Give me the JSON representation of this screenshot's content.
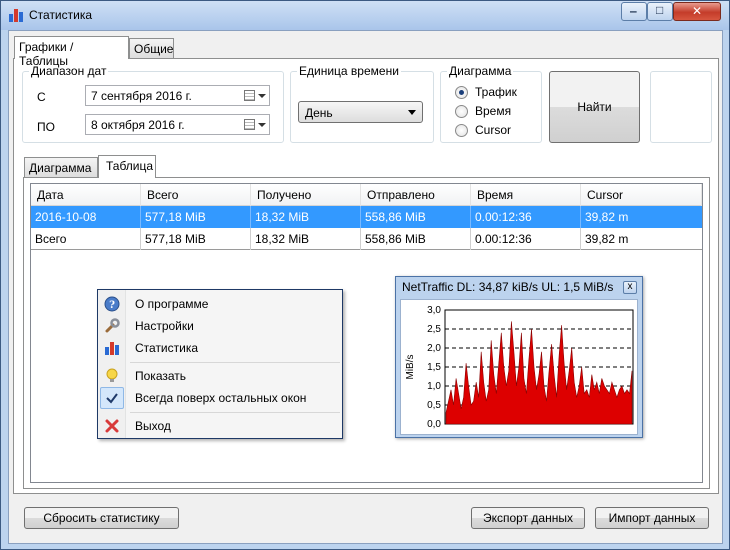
{
  "window": {
    "title": "Статистика",
    "controls": {
      "minimize": "‒",
      "maximize": "□",
      "close": "✕"
    }
  },
  "tabs": [
    {
      "label": "Графики / Таблицы",
      "active": true
    },
    {
      "label": "Общие",
      "active": false
    }
  ],
  "date_range": {
    "title": "Диапазон дат",
    "from_label": "С",
    "from_value": "7 сентября 2016 г.",
    "to_label": "ПО",
    "to_value": "8  октября  2016 г."
  },
  "time_unit": {
    "title": "Единица времени",
    "selected": "День"
  },
  "diagram": {
    "title": "Диаграмма",
    "options": [
      {
        "label": "Трафик",
        "selected": true
      },
      {
        "label": "Время",
        "selected": false
      },
      {
        "label": "Cursor",
        "selected": false
      }
    ]
  },
  "find_button": "Найти",
  "sub_tabs": [
    {
      "label": "Диаграмма",
      "active": false
    },
    {
      "label": "Таблица",
      "active": true
    }
  ],
  "table": {
    "columns": [
      "Дата",
      "Всего",
      "Получено",
      "Отправлено",
      "Время",
      "Cursor"
    ],
    "rows": [
      [
        "2016-10-08",
        "577,18 MiB",
        "18,32 MiB",
        "558,86 MiB",
        "0.00:12:36",
        "39,82 m"
      ],
      [
        "Всего",
        "577,18 MiB",
        "18,32 MiB",
        "558,86 MiB",
        "0.00:12:36",
        "39,82 m"
      ]
    ]
  },
  "context_menu": {
    "items": [
      {
        "label": "О программе",
        "icon": "info-icon"
      },
      {
        "label": "Настройки",
        "icon": "wrench-icon"
      },
      {
        "label": "Статистика",
        "icon": "bar-chart-icon"
      },
      {
        "label": "Показать",
        "icon": "lightbulb-icon"
      },
      {
        "label": "Всегда поверх остальных окон",
        "icon": "check-icon",
        "checked": true
      },
      {
        "label": "Выход",
        "icon": "close-x-icon"
      }
    ]
  },
  "mini_window": {
    "title": "NetTraffic DL: 34,87 kiB/s UL: 1,5 MiB/s",
    "close": "x"
  },
  "chart_data": {
    "type": "area",
    "ylabel": "MiB/s",
    "ylim": [
      0,
      3
    ],
    "yticks": [
      "0,0",
      "0,5",
      "1,0",
      "1,5",
      "2,0",
      "2,5",
      "3,0"
    ],
    "grid": true,
    "color": "#dd0000",
    "values": [
      0.3,
      0.6,
      0.9,
      0.5,
      1.2,
      0.8,
      0.4,
      0.7,
      1.6,
      1.0,
      0.5,
      0.6,
      1.1,
      0.7,
      1.9,
      1.1,
      0.6,
      0.9,
      2.2,
      1.3,
      0.8,
      1.6,
      2.4,
      1.5,
      1.0,
      1.4,
      2.7,
      1.9,
      1.0,
      1.5,
      2.4,
      1.2,
      0.8,
      1.7,
      2.5,
      1.5,
      0.9,
      1.3,
      1.9,
      1.0,
      0.6,
      1.4,
      2.1,
      1.3,
      0.7,
      1.8,
      2.6,
      1.6,
      0.9,
      1.4,
      2.0,
      1.1,
      0.7,
      1.0,
      1.5,
      0.8,
      0.9,
      0.7,
      1.3,
      0.9,
      1.1,
      0.8,
      1.2,
      1.0,
      0.9,
      0.8,
      1.1,
      0.9,
      0.7,
      0.9,
      1.0,
      0.8,
      0.9,
      0.8,
      1.4
    ]
  },
  "bottom_buttons": {
    "reset": "Сбросить статистику",
    "export": "Экспорт данных",
    "import": "Импорт данных"
  }
}
